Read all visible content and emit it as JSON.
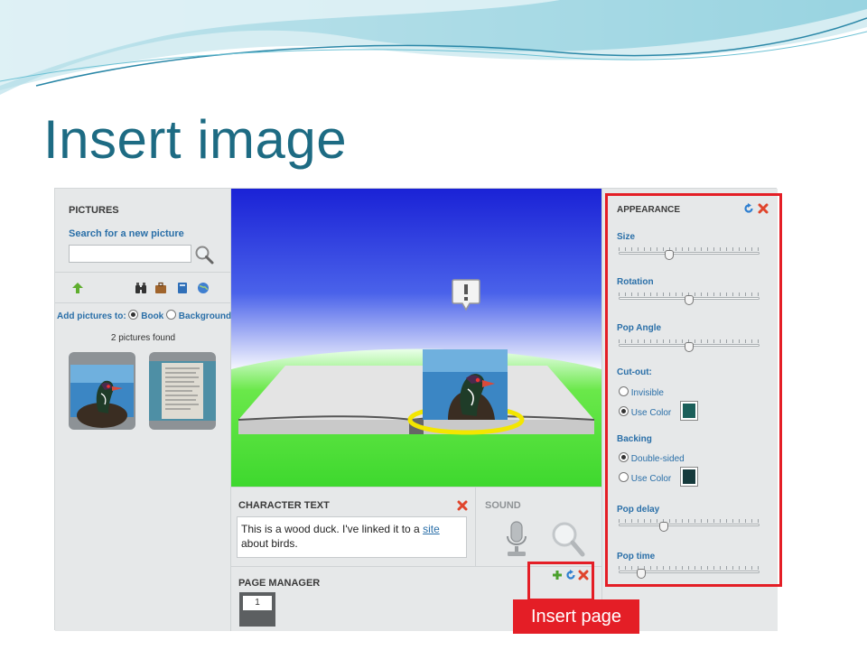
{
  "slide": {
    "title": "Insert image",
    "callout_label": "Insert page"
  },
  "pictures": {
    "header": "PICTURES",
    "search_link": "Search for a new picture",
    "search_value": "",
    "add_to_label": "Add pictures to:",
    "option_book": "Book",
    "option_background": "Background",
    "selected_option": "Book",
    "found_count": "2 pictures found"
  },
  "character_text": {
    "header": "CHARACTER TEXT",
    "text_before": "This is a wood duck.  I've linked it to a ",
    "link_text": "site",
    "text_after": "about birds."
  },
  "sound": {
    "header": "SOUND"
  },
  "page_manager": {
    "header": "PAGE MANAGER",
    "page_number": "1"
  },
  "appearance": {
    "header": "APPEARANCE",
    "size_label": "Size",
    "size_value": 0.36,
    "rotation_label": "Rotation",
    "rotation_value": 0.5,
    "pop_angle_label": "Pop Angle",
    "pop_angle_value": 0.5,
    "cutout_label": "Cut-out:",
    "cutout_invisible": "Invisible",
    "cutout_use_color": "Use Color",
    "cutout_selected": "Use Color",
    "cutout_color": "#1b5f5a",
    "backing_label": "Backing",
    "backing_double": "Double-sided",
    "backing_use_color": "Use Color",
    "backing_selected": "Double-sided",
    "backing_color": "#163a3c",
    "pop_delay_label": "Pop delay",
    "pop_delay_value": 0.32,
    "pop_time_label": "Pop time",
    "pop_time_value": 0.16
  },
  "colors": {
    "title": "#1d6b83",
    "link": "#2a6fa8",
    "highlight": "#e41e26"
  }
}
